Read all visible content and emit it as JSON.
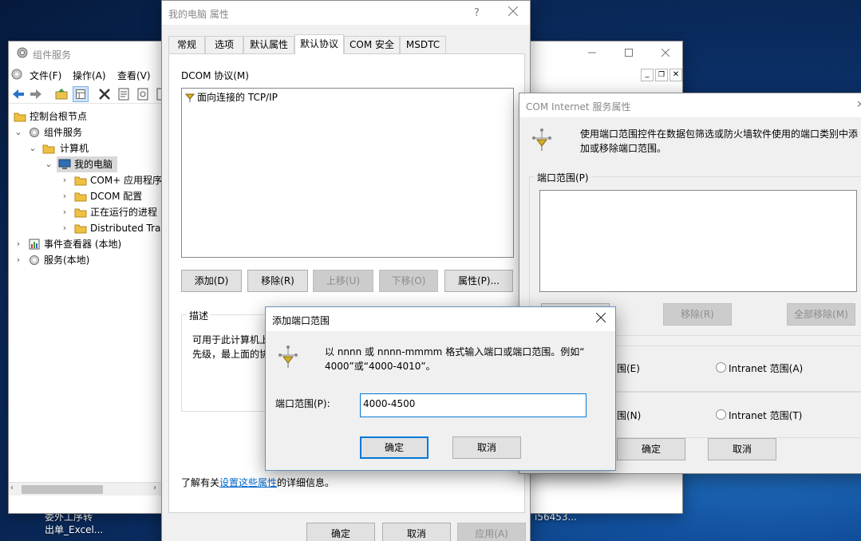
{
  "taskbar": {
    "file1_line1": "委外工序转",
    "file1_line2": "出单_Excel...",
    "file2": "i56453..."
  },
  "component_services": {
    "title": "组件服务",
    "menu": [
      "文件(F)",
      "操作(A)",
      "查看(V)"
    ],
    "tree": {
      "root": "控制台根节点",
      "component_services": "组件服务",
      "computers": "计算机",
      "my_computer": "我的电脑",
      "com_apps": "COM+ 应用程序",
      "dcom_config": "DCOM 配置",
      "running": "正在运行的进程",
      "dtc": "Distributed Trar",
      "event_viewer": "事件查看器 (本地)",
      "services": "服务(本地)"
    }
  },
  "my_computer_props": {
    "title": "我的电脑 属性",
    "help": "?",
    "tabs": [
      "常规",
      "选项",
      "默认属性",
      "默认协议",
      "COM 安全",
      "MSDTC"
    ],
    "protocol_label": "DCOM 协议(M)",
    "protocols": [
      "面向连接的 TCP/IP"
    ],
    "buttons": {
      "add": "添加(D)",
      "remove": "移除(R)",
      "up": "上移(U)",
      "down": "下移(O)",
      "properties": "属性(P)..."
    },
    "description_title": "描述",
    "description_line1": "可用于此计算机上",
    "description_line2": "先级，最上面的协",
    "info_prefix": "了解有关",
    "info_link": "设置这些属性",
    "info_suffix": "的详细信息。",
    "ok": "确定",
    "cancel": "取消",
    "apply": "应用(A)"
  },
  "com_internet": {
    "title": "COM Internet 服务属性",
    "description_line1": "使用端口范围控件在数据包筛选或防火墙软件使用的端口类别中添",
    "description_line2": "加或移除端口范围。",
    "port_ranges_label": "端口范围(P)",
    "remove": "移除(R)",
    "remove_all": "全部移除(M)",
    "radio_row1_left": "围(E)",
    "radio_row1_right": "Intranet 范围(A)",
    "radio_row2_left": "围(N)",
    "radio_row2_right": "Intranet 范围(T)",
    "ok": "确定",
    "cancel": "取消"
  },
  "add_port_range": {
    "title": "添加端口范围",
    "instruction_line1": "以 nnnn 或 nnnn-mmmm 格式输入端口或端口范围。例如“",
    "instruction_line2": "4000”或“4000-4010”。",
    "field_label": "端口范围(P):",
    "field_value": "4000-4500",
    "ok": "确定",
    "cancel": "取消"
  },
  "colors": {
    "accent": "#0078d7",
    "link": "#0066cc",
    "folder": "#f0c040",
    "dialog_bg": "#f0f0f0"
  },
  "icons": {
    "folder": "folder-icon",
    "computer": "computer-icon",
    "gear": "gear-icon",
    "network": "network-protocol-icon",
    "close": "close-icon"
  }
}
